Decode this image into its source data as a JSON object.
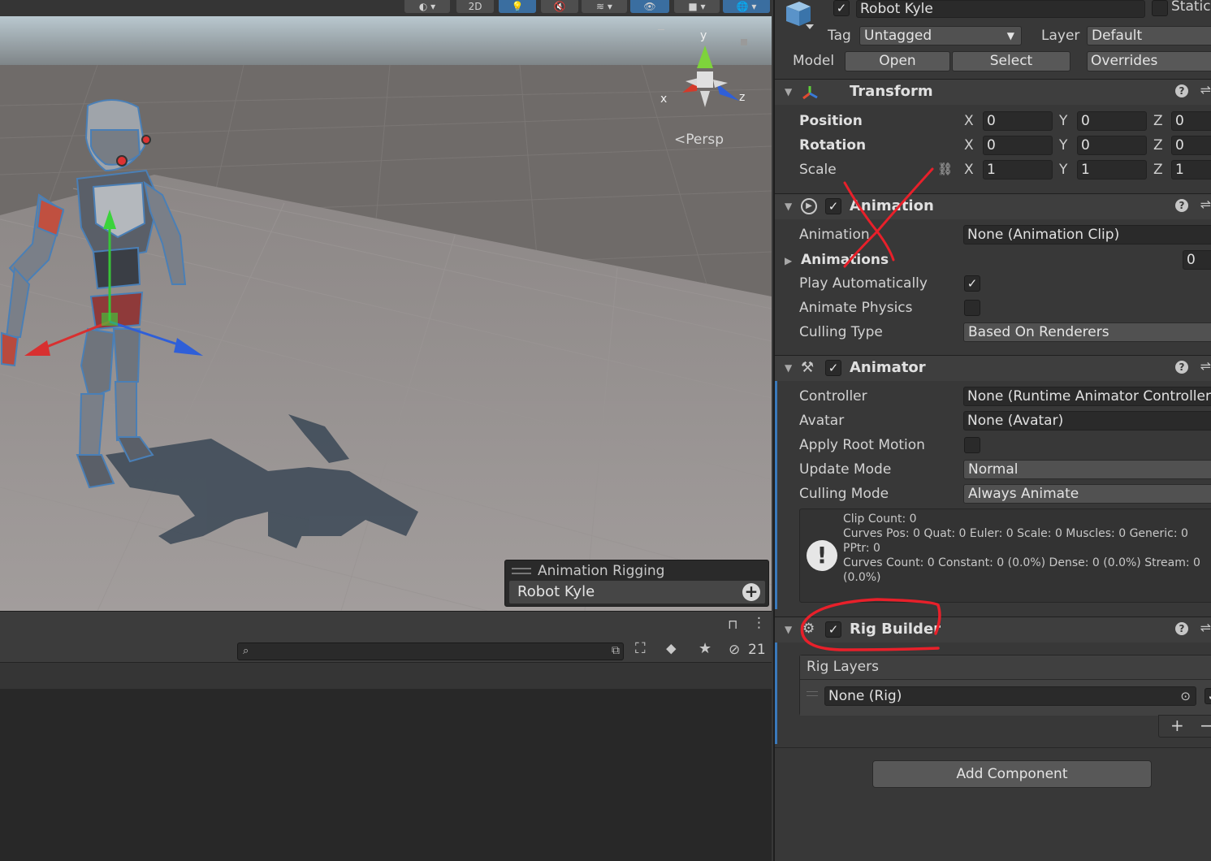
{
  "scene": {
    "toolbar": {
      "mode_2d_label": "2D"
    },
    "gizmo": {
      "y_label": "y",
      "x_label": "x",
      "z_label": "z"
    },
    "persp_label": "Persp",
    "overlay": {
      "title": "Animation Rigging",
      "item_label": "Robot Kyle"
    }
  },
  "bottom": {
    "search": {
      "placeholder": ""
    },
    "hidden_count": "21"
  },
  "inspector": {
    "object_name": "Robot Kyle",
    "static_label": "Static",
    "tag_label": "Tag",
    "tag_value": "Untagged",
    "layer_label": "Layer",
    "layer_value": "Default",
    "model_label": "Model",
    "model_buttons": {
      "open": "Open",
      "select": "Select",
      "overrides": "Overrides"
    },
    "transform": {
      "title": "Transform",
      "position_label": "Position",
      "rotation_label": "Rotation",
      "scale_label": "Scale",
      "axis_x": "X",
      "axis_y": "Y",
      "axis_z": "Z",
      "position": {
        "x": "0",
        "y": "0",
        "z": "0"
      },
      "rotation": {
        "x": "0",
        "y": "0",
        "z": "0"
      },
      "scale": {
        "x": "1",
        "y": "1",
        "z": "1"
      }
    },
    "animation": {
      "title": "Animation",
      "animation_label": "Animation",
      "animation_value": "None (Animation Clip)",
      "animations_label": "Animations",
      "animations_count": "0",
      "play_automatically_label": "Play Automatically",
      "play_automatically": true,
      "animate_physics_label": "Animate Physics",
      "animate_physics": false,
      "culling_type_label": "Culling Type",
      "culling_type_value": "Based On Renderers"
    },
    "animator": {
      "title": "Animator",
      "controller_label": "Controller",
      "controller_value": "None (Runtime Animator Controller)",
      "avatar_label": "Avatar",
      "avatar_value": "None (Avatar)",
      "apply_root_motion_label": "Apply Root Motion",
      "update_mode_label": "Update Mode",
      "update_mode_value": "Normal",
      "culling_mode_label": "Culling Mode",
      "culling_mode_value": "Always Animate",
      "info": {
        "line1": "Clip Count: 0",
        "line2": "Curves Pos: 0 Quat: 0 Euler: 0 Scale: 0 Muscles: 0 Generic: 0",
        "line3": "PPtr: 0",
        "line4": "Curves Count: 0 Constant: 0 (0.0%) Dense: 0 (0.0%) Stream: 0",
        "line5": "(0.0%)"
      }
    },
    "rig_builder": {
      "title": "Rig Builder",
      "rig_layers_label": "Rig Layers",
      "layer_value": "None (Rig)"
    },
    "add_component_label": "Add Component"
  },
  "colors": {
    "accent_blue": "#3a79bb",
    "annotation_red": "#e8202a",
    "panel_bg": "#383838"
  }
}
